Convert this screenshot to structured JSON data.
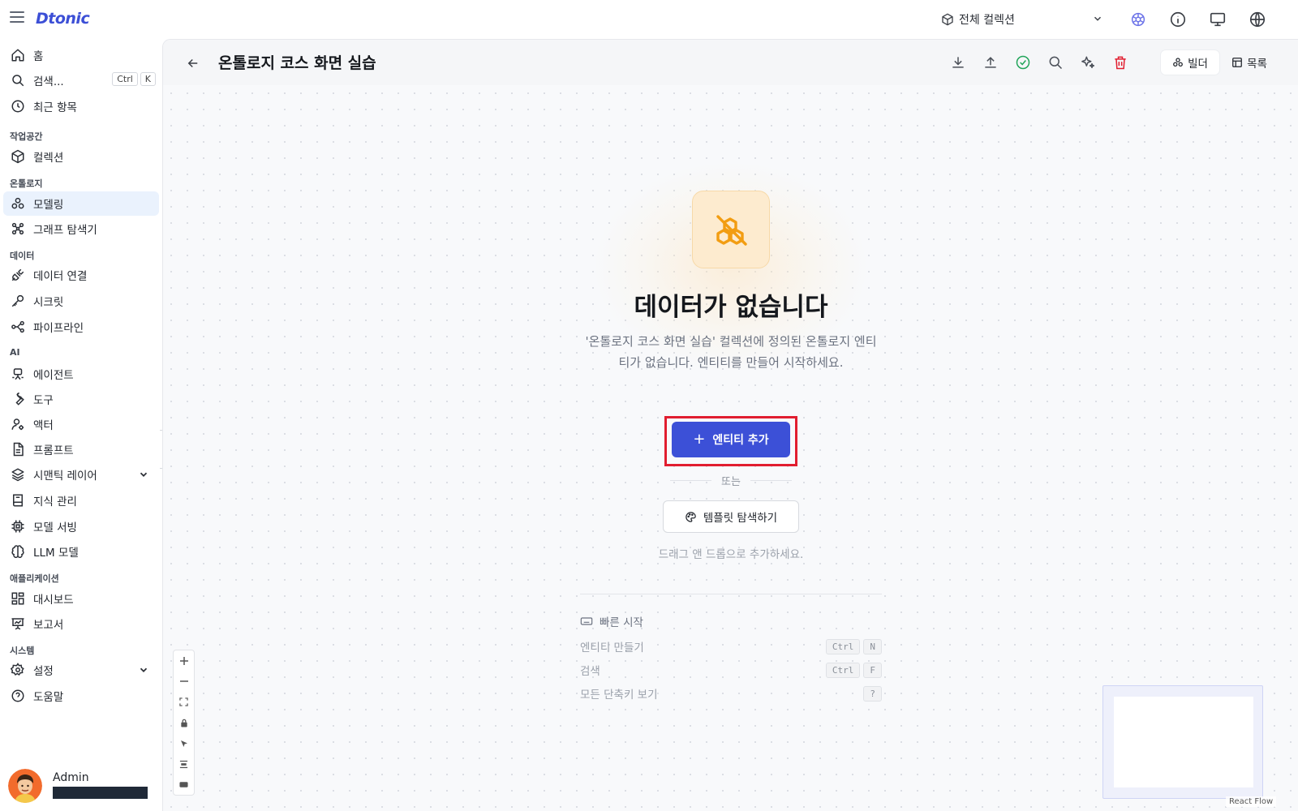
{
  "app": {
    "logo": "Dtonic"
  },
  "topbar": {
    "collection_label": "전체 컬렉션",
    "icons": [
      "hamburger-icon",
      "ontology-badge-icon",
      "info-icon",
      "monitor-icon",
      "globe-icon"
    ]
  },
  "sidebar": {
    "top": [
      {
        "label": "홈",
        "icon": "home-icon"
      },
      {
        "label": "검색...",
        "icon": "search-icon",
        "kbd": [
          "Ctrl",
          "K"
        ]
      },
      {
        "label": "최근 항목",
        "icon": "clock-icon"
      }
    ],
    "sections": {
      "workspace": "작업공간",
      "ontology": "온톨로지",
      "data": "데이터",
      "ai": "AI",
      "applications": "애플리케이션",
      "system": "시스템"
    },
    "items": {
      "collections": "컬렉션",
      "modeling": "모델링",
      "graph_explorer": "그래프 탐색기",
      "data_connection": "데이터 연결",
      "secrets": "시크릿",
      "pipeline": "파이프라인",
      "agent": "에이전트",
      "tools": "도구",
      "actor": "액터",
      "prompt": "프롬프트",
      "semantic_layer": "시맨틱 레이어",
      "knowledge": "지식 관리",
      "model_serving": "모델 서빙",
      "llm_models": "LLM 모델",
      "dashboard": "대시보드",
      "reports": "보고서",
      "settings": "설정",
      "help": "도움말"
    },
    "user": {
      "name": "Admin"
    }
  },
  "header": {
    "title": "온톨로지 코스 화면 실습",
    "builder_label": "빌더",
    "list_label": "목록"
  },
  "empty_state": {
    "title": "데이터가 없습니다",
    "description": "'온톨로지 코스 화면 실습' 컬렉션에 정의된 온톨로지 엔티티가 없습니다. 엔티티를 만들어 시작하세요.",
    "add_button": "엔티티 추가",
    "or_label": "또는",
    "template_button": "템플릿 탐색하기",
    "dnd_hint": "드래그 앤 드롭으로 추가하세요."
  },
  "quick_start": {
    "title": "빠른 시작",
    "rows": [
      {
        "label": "엔티티 만들기",
        "keys": [
          "Ctrl",
          "N"
        ]
      },
      {
        "label": "검색",
        "keys": [
          "Ctrl",
          "F"
        ]
      },
      {
        "label": "모든 단축키 보기",
        "keys": [
          "?"
        ]
      }
    ]
  },
  "canvas": {
    "attribution": "React Flow"
  },
  "colors": {
    "accent": "#3c50d7",
    "warning": "#f29d12",
    "danger": "#e11d2f",
    "success": "#22a55a"
  }
}
